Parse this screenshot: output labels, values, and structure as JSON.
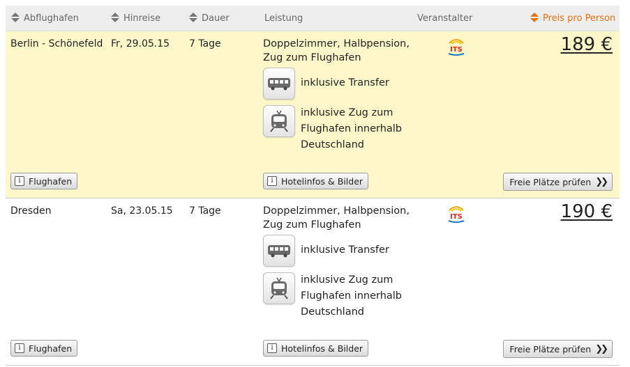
{
  "header": {
    "columns": [
      {
        "label": "Abflughafen",
        "sortable": true
      },
      {
        "label": "Hinreise",
        "sortable": true
      },
      {
        "label": "Dauer",
        "sortable": true
      },
      {
        "label": "Leistung",
        "sortable": false
      },
      {
        "label": "Veranstalter",
        "sortable": false
      },
      {
        "label": "Preis pro Person",
        "sortable": true,
        "active": true
      }
    ]
  },
  "colors": {
    "header_bg": "#eeeeee",
    "highlight_row": "#fdf7c9",
    "active_sort": "#e8700e"
  },
  "offers": [
    {
      "airport": "Berlin - Schönefeld",
      "date": "Fr, 29.05.15",
      "duration": "7 Tage",
      "service": "Doppelzimmer, Halbpension, Zug zum Flughafen",
      "features": [
        {
          "icon": "bus-icon",
          "text": "inklusive Transfer"
        },
        {
          "icon": "train-icon",
          "text": "inklusive Zug zum Flughafen innerhalb Deutschland"
        }
      ],
      "operator_logo": "its-logo",
      "price": "189 €",
      "buttons": {
        "airport": "Flughafen",
        "hotel": "Hotelinfos & Bilder",
        "check": "Freie Plätze prüfen"
      }
    },
    {
      "airport": "Dresden",
      "date": "Sa, 23.05.15",
      "duration": "7 Tage",
      "service": "Doppelzimmer, Halbpension, Zug zum Flughafen",
      "features": [
        {
          "icon": "bus-icon",
          "text": "inklusive Transfer"
        },
        {
          "icon": "train-icon",
          "text": "inklusive Zug zum Flughafen innerhalb Deutschland"
        }
      ],
      "operator_logo": "its-logo",
      "price": "190 €",
      "buttons": {
        "airport": "Flughafen",
        "hotel": "Hotelinfos & Bilder",
        "check": "Freie Plätze prüfen"
      }
    }
  ]
}
